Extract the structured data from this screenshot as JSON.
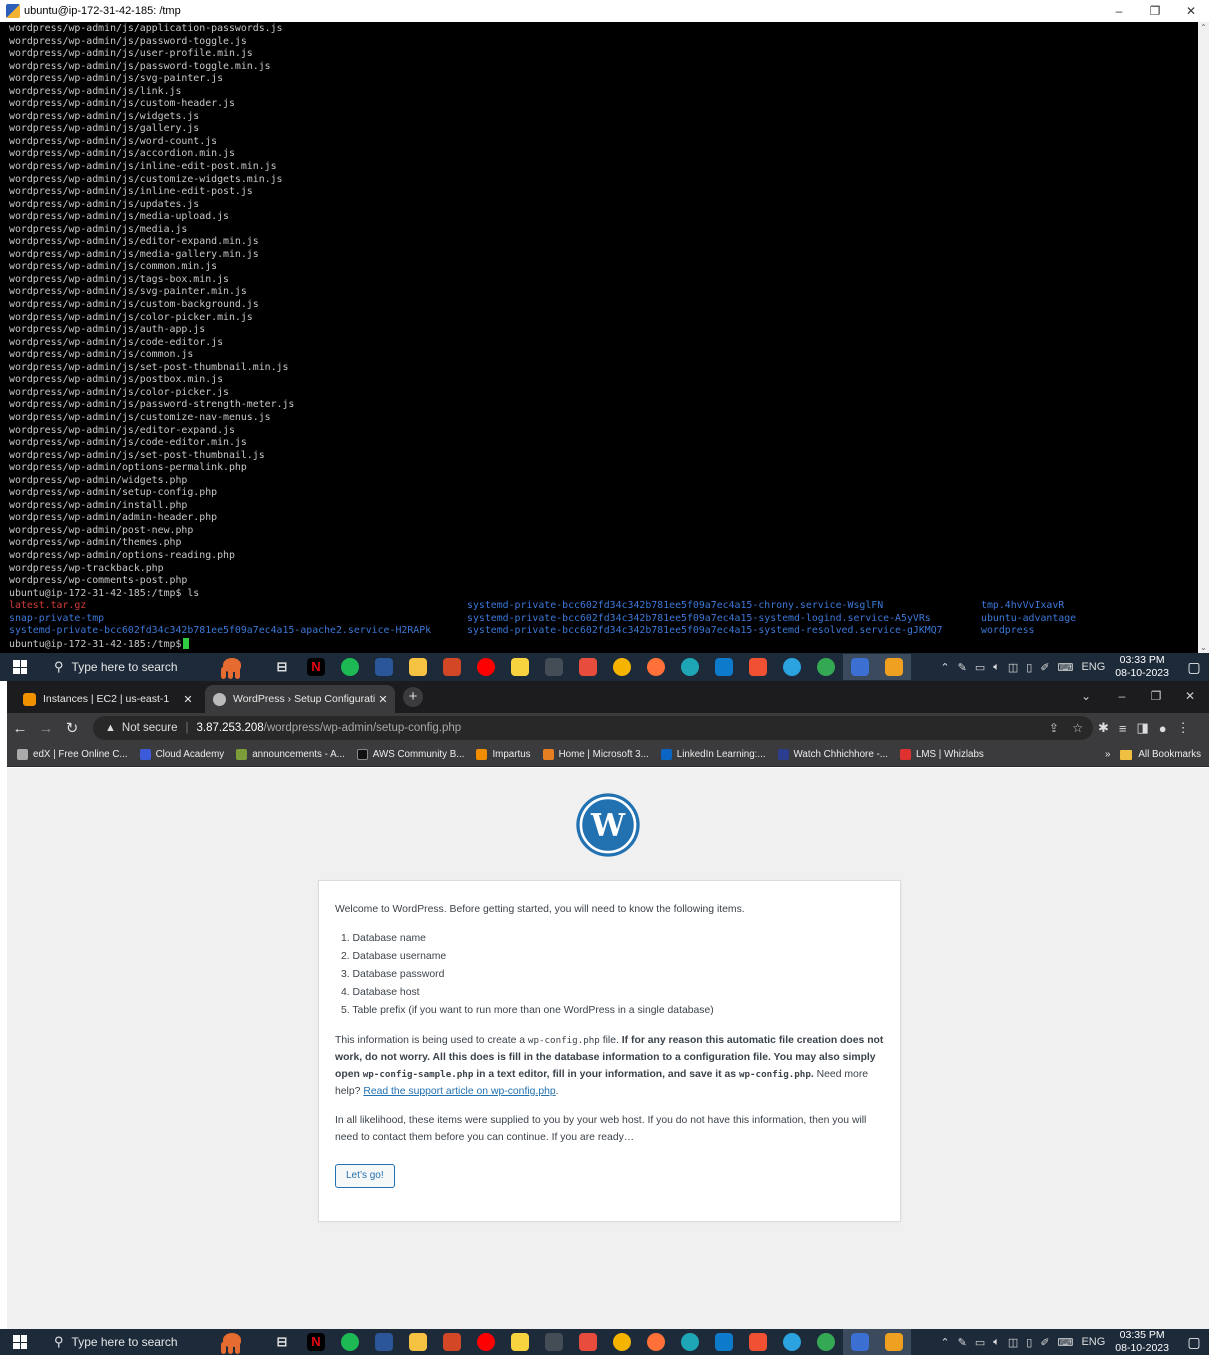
{
  "terminal": {
    "title": "ubuntu@ip-172-31-42-185: /tmp",
    "controls": {
      "minimize": "–",
      "restore": "❐",
      "close": "✕"
    },
    "lines": [
      "wordpress/wp-admin/js/application-passwords.js",
      "wordpress/wp-admin/js/password-toggle.js",
      "wordpress/wp-admin/js/user-profile.min.js",
      "wordpress/wp-admin/js/password-toggle.min.js",
      "wordpress/wp-admin/js/svg-painter.js",
      "wordpress/wp-admin/js/link.js",
      "wordpress/wp-admin/js/custom-header.js",
      "wordpress/wp-admin/js/widgets.js",
      "wordpress/wp-admin/js/gallery.js",
      "wordpress/wp-admin/js/word-count.js",
      "wordpress/wp-admin/js/accordion.min.js",
      "wordpress/wp-admin/js/inline-edit-post.min.js",
      "wordpress/wp-admin/js/customize-widgets.min.js",
      "wordpress/wp-admin/js/inline-edit-post.js",
      "wordpress/wp-admin/js/updates.js",
      "wordpress/wp-admin/js/media-upload.js",
      "wordpress/wp-admin/js/media.js",
      "wordpress/wp-admin/js/editor-expand.min.js",
      "wordpress/wp-admin/js/media-gallery.min.js",
      "wordpress/wp-admin/js/common.min.js",
      "wordpress/wp-admin/js/tags-box.min.js",
      "wordpress/wp-admin/js/svg-painter.min.js",
      "wordpress/wp-admin/js/custom-background.js",
      "wordpress/wp-admin/js/color-picker.min.js",
      "wordpress/wp-admin/js/auth-app.js",
      "wordpress/wp-admin/js/code-editor.js",
      "wordpress/wp-admin/js/common.js",
      "wordpress/wp-admin/js/set-post-thumbnail.min.js",
      "wordpress/wp-admin/js/postbox.min.js",
      "wordpress/wp-admin/js/color-picker.js",
      "wordpress/wp-admin/js/password-strength-meter.js",
      "wordpress/wp-admin/js/customize-nav-menus.js",
      "wordpress/wp-admin/js/editor-expand.js",
      "wordpress/wp-admin/js/code-editor.min.js",
      "wordpress/wp-admin/js/set-post-thumbnail.js",
      "wordpress/wp-admin/options-permalink.php",
      "wordpress/wp-admin/widgets.php",
      "wordpress/wp-admin/setup-config.php",
      "wordpress/wp-admin/install.php",
      "wordpress/wp-admin/admin-header.php",
      "wordpress/wp-admin/post-new.php",
      "wordpress/wp-admin/themes.php",
      "wordpress/wp-admin/options-reading.php",
      "wordpress/wp-trackback.php",
      "wordpress/wp-comments-post.php",
      "ubuntu@ip-172-31-42-185:/tmp$ ls"
    ],
    "ls_output": [
      {
        "c1": "latest.tar.gz",
        "c1_class": "red",
        "c2": "systemd-private-bcc602fd34c342b781ee5f09a7ec4a15-chrony.service-WsglFN",
        "c3": "tmp.4hvVvIxavR"
      },
      {
        "c1": "snap-private-tmp",
        "c1_class": "blue",
        "c2": "systemd-private-bcc602fd34c342b781ee5f09a7ec4a15-systemd-logind.service-A5yVRs",
        "c3": "ubuntu-advantage"
      },
      {
        "c1": "systemd-private-bcc602fd34c342b781ee5f09a7ec4a15-apache2.service-H2RAPk",
        "c1_class": "blue",
        "c2": "systemd-private-bcc602fd34c342b781ee5f09a7ec4a15-systemd-resolved.service-gJKMQ7",
        "c3": "wordpress"
      }
    ],
    "prompt": "ubuntu@ip-172-31-42-185:/tmp$"
  },
  "taskbar_top": {
    "search_placeholder": "Type here to search",
    "lang": "ENG",
    "time": "03:33 PM",
    "date": "08-10-2023"
  },
  "taskbar_bottom": {
    "search_placeholder": "Type here to search",
    "lang": "ENG",
    "time": "03:35 PM",
    "date": "08-10-2023"
  },
  "taskbar_apps": [
    {
      "name": "task-view",
      "color": "#1d2a3a",
      "glyph": "⊟"
    },
    {
      "name": "netflix",
      "color": "#000000",
      "glyph": "N",
      "fg": "#e50914"
    },
    {
      "name": "spotify",
      "color": "#1db954"
    },
    {
      "name": "word",
      "color": "#2b579a"
    },
    {
      "name": "file-explorer",
      "color": "#f5c242"
    },
    {
      "name": "powerpoint",
      "color": "#d24726"
    },
    {
      "name": "youtube",
      "color": "#ff0000"
    },
    {
      "name": "sticky-notes",
      "color": "#f7d33f"
    },
    {
      "name": "terminal",
      "color": "#444c56"
    },
    {
      "name": "calendar",
      "color": "#e74c3c"
    },
    {
      "name": "chrome",
      "color": "#f4b400"
    },
    {
      "name": "firefox",
      "color": "#ff7139"
    },
    {
      "name": "edge",
      "color": "#1fa6b6"
    },
    {
      "name": "vscode",
      "color": "#0e7acc"
    },
    {
      "name": "git",
      "color": "#f05133"
    },
    {
      "name": "telegram",
      "color": "#2aa3e0"
    },
    {
      "name": "chrome-profile",
      "color": "#34a853"
    },
    {
      "name": "putty",
      "color": "#3b6fd1",
      "active": true
    },
    {
      "name": "whizlabs",
      "color": "#f0a020",
      "active": true
    }
  ],
  "browser": {
    "tabs": [
      {
        "label": "Instances | EC2 | us-east-1",
        "favicon_color": "#f29100"
      },
      {
        "label": "WordPress › Setup Configuratio",
        "favicon_color": "#bbbbbb"
      }
    ],
    "omnibox": {
      "security": "Not secure",
      "host": "3.87.253.208",
      "path": "/wordpress/wp-admin/setup-config.php"
    },
    "bookmarks": [
      {
        "label": "edX | Free Online C...",
        "color": "#aaaaaa"
      },
      {
        "label": "Cloud Academy",
        "color": "#3b5bdb"
      },
      {
        "label": "announcements - A...",
        "color": "#7b9e3b"
      },
      {
        "label": "AWS Community B...",
        "color": "#111111"
      },
      {
        "label": "Impartus",
        "color": "#f08c00"
      },
      {
        "label": "Home | Microsoft 3...",
        "color": "#e67e22"
      },
      {
        "label": "LinkedIn Learning:...",
        "color": "#0a66c2"
      },
      {
        "label": "Watch Chhichhore -...",
        "color": "#2c3e8f"
      },
      {
        "label": "LMS | Whizlabs",
        "color": "#e03131"
      }
    ],
    "bookmarks_more": "»",
    "all_bookmarks": "All Bookmarks"
  },
  "wp": {
    "intro": "Welcome to WordPress. Before getting started, you will need to know the following items.",
    "items": [
      "1. Database name",
      "2. Database username",
      "3. Database password",
      "4. Database host",
      "5. Table prefix (if you want to run more than one WordPress in a single database)"
    ],
    "info_prefix": "This information is being used to create a ",
    "info_code1": "wp-config.php",
    "info_mid1": " file. ",
    "info_bold1": "If for any reason this automatic file creation does not work, do not worry. All this does is fill in the database information to a configuration file. You may also simply open ",
    "info_code2": "wp-config-sample.php",
    "info_bold2": " in a text editor, fill in your information, and save it as ",
    "info_code3": "wp-config.php",
    "info_bold3": ".",
    "info_help": " Need more help? ",
    "info_link": "Read the support article on wp-config.php",
    "info_end": ".",
    "host_note": "In all likelihood, these items were supplied to you by your web host. If you do not have this information, then you will need to contact them before you can continue. If you are ready…",
    "button": "Let’s go!"
  }
}
